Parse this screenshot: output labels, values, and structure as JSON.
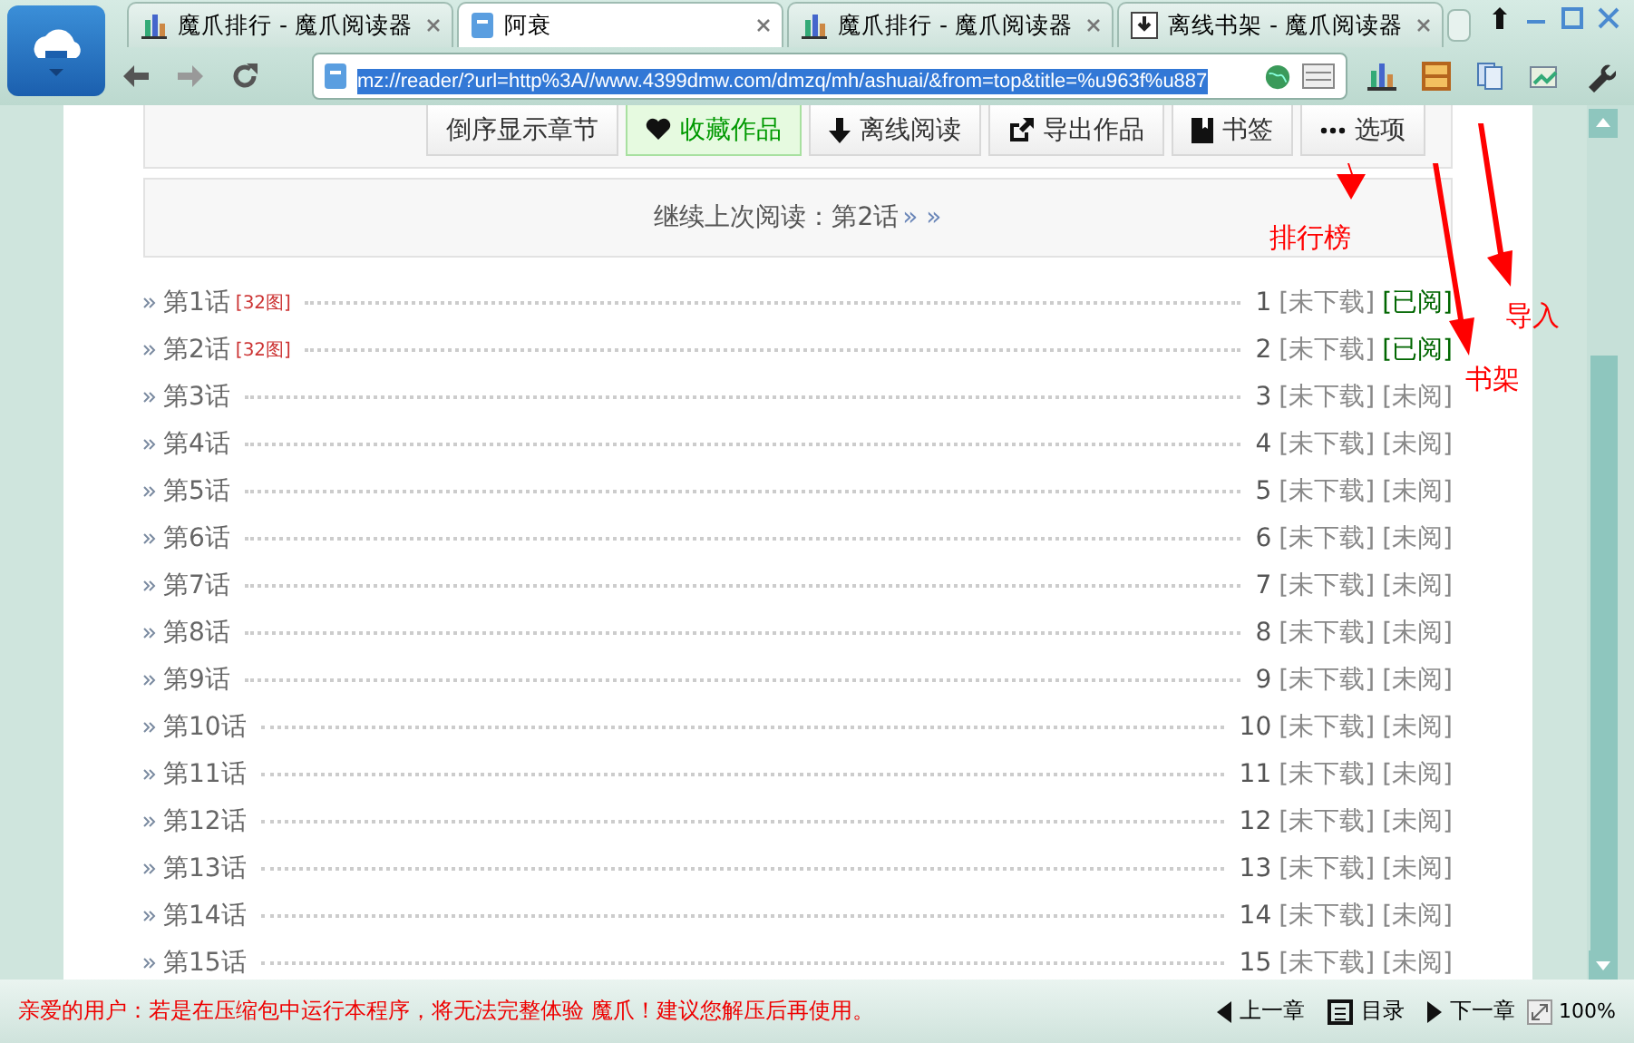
{
  "tabs": [
    {
      "kind": "chart",
      "title": "魔爪排行 - 魔爪阅读器",
      "selected": false
    },
    {
      "kind": "page",
      "title": "阿衰",
      "selected": true
    },
    {
      "kind": "chart",
      "title": "魔爪排行 - 魔爪阅读器",
      "selected": false
    },
    {
      "kind": "download",
      "title": "离线书架 - 魔爪阅读器",
      "selected": false
    }
  ],
  "address": {
    "value": "mz://reader/?url=http%3A//www.4399dmw.com/dmzq/mh/ashuai/&from=top&title=%u963f%u887"
  },
  "actions": [
    {
      "kind": "none",
      "label": "倒序显示章节",
      "selected": false
    },
    {
      "kind": "heart",
      "label": "收藏作品",
      "selected": true
    },
    {
      "kind": "download",
      "label": "离线阅读",
      "selected": false
    },
    {
      "kind": "export",
      "label": "导出作品",
      "selected": false
    },
    {
      "kind": "bookmark",
      "label": "书签",
      "selected": false
    },
    {
      "kind": "more",
      "label": "选项",
      "selected": false
    }
  ],
  "continue_bar": {
    "label": "继续上次阅读：",
    "chapter": "第2话",
    "arrows": "» »"
  },
  "chapters": [
    {
      "title": "第1话",
      "tag": "[32图]",
      "number": "1",
      "download": "[未下载]",
      "status": "[已阅]",
      "read": true
    },
    {
      "title": "第2话",
      "tag": "[32图]",
      "number": "2",
      "download": "[未下载]",
      "status": "[已阅]",
      "read": true
    },
    {
      "title": "第3话",
      "number": "3",
      "download": "[未下载]",
      "status": "[未阅]",
      "read": false
    },
    {
      "title": "第4话",
      "number": "4",
      "download": "[未下载]",
      "status": "[未阅]",
      "read": false
    },
    {
      "title": "第5话",
      "number": "5",
      "download": "[未下载]",
      "status": "[未阅]",
      "read": false
    },
    {
      "title": "第6话",
      "number": "6",
      "download": "[未下载]",
      "status": "[未阅]",
      "read": false
    },
    {
      "title": "第7话",
      "number": "7",
      "download": "[未下载]",
      "status": "[未阅]",
      "read": false
    },
    {
      "title": "第8话",
      "number": "8",
      "download": "[未下载]",
      "status": "[未阅]",
      "read": false
    },
    {
      "title": "第9话",
      "number": "9",
      "download": "[未下载]",
      "status": "[未阅]",
      "read": false
    },
    {
      "title": "第10话",
      "number": "10",
      "download": "[未下载]",
      "status": "[未阅]",
      "read": false
    },
    {
      "title": "第11话",
      "number": "11",
      "download": "[未下载]",
      "status": "[未阅]",
      "read": false
    },
    {
      "title": "第12话",
      "number": "12",
      "download": "[未下载]",
      "status": "[未阅]",
      "read": false
    },
    {
      "title": "第13话",
      "number": "13",
      "download": "[未下载]",
      "status": "[未阅]",
      "read": false
    },
    {
      "title": "第14话",
      "number": "14",
      "download": "[未下载]",
      "status": "[未阅]",
      "read": false
    },
    {
      "title": "第15话",
      "number": "15",
      "download": "[未下载]",
      "status": "[未阅]",
      "read": false
    }
  ],
  "annotations": [
    {
      "label": "排行榜"
    },
    {
      "label": "书架"
    },
    {
      "label": "导入"
    }
  ],
  "status_bar": {
    "message": "亲爱的用户：若是在压缩包中运行本程序，将无法完整体验 魔爪！建议您解压后再使用。",
    "prev": "上一章",
    "toc": "目录",
    "next": "下一章",
    "zoom": "100%"
  }
}
